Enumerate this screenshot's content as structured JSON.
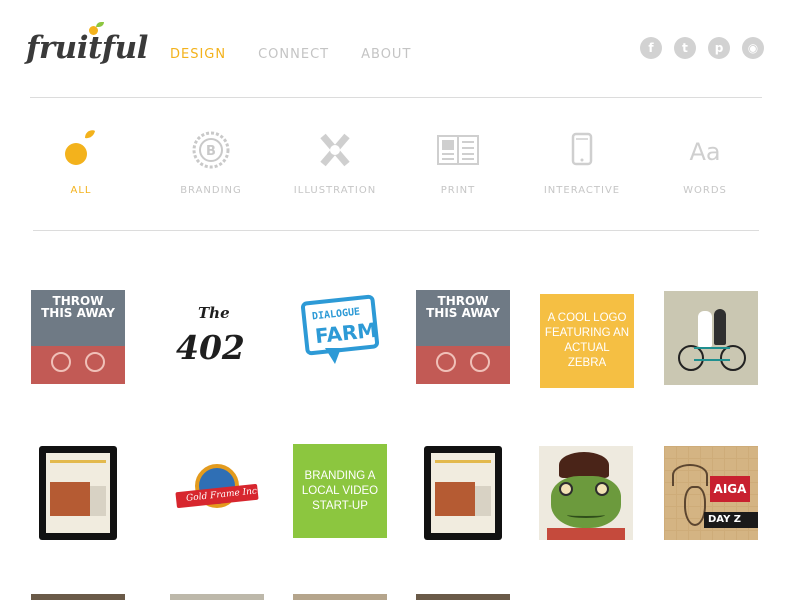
{
  "header": {
    "logo_text": "fruitful",
    "nav": [
      {
        "label": "DESIGN",
        "active": true
      },
      {
        "label": "CONNECT",
        "active": false
      },
      {
        "label": "ABOUT",
        "active": false
      }
    ],
    "social": [
      {
        "icon": "facebook-icon",
        "glyph": "f"
      },
      {
        "icon": "twitter-icon",
        "glyph": "t"
      },
      {
        "icon": "pinterest-icon",
        "glyph": "p"
      },
      {
        "icon": "instagram-icon",
        "glyph": "◉"
      }
    ]
  },
  "categories": [
    {
      "label": "ALL",
      "icon": "fruit-icon",
      "active": true
    },
    {
      "label": "BRANDING",
      "icon": "badge-b-icon",
      "active": false
    },
    {
      "label": "ILLUSTRATION",
      "icon": "crossed-pencils-icon",
      "active": false
    },
    {
      "label": "PRINT",
      "icon": "newspaper-icon",
      "active": false
    },
    {
      "label": "INTERACTIVE",
      "icon": "tablet-icon",
      "active": false
    },
    {
      "label": "WORDS",
      "icon": "typography-icon",
      "active": false
    }
  ],
  "category_icon_glyphs": {
    "branding": "B",
    "words": "Aa"
  },
  "portfolio": {
    "row1": {
      "poster_text": "THROW THIS AWAY",
      "the402_small": "The",
      "the402_big": "402",
      "dialogue_line1": "DIALOGUE",
      "dialogue_line2": "FARM",
      "poster2_text": "THROW THIS AWAY",
      "zebra_text": "A cool logo featuring an actual zebra"
    },
    "row2": {
      "badge_text": "Gold Frame Inc.",
      "video_text": "Branding a local video start-up",
      "aiga_text": "AIGA",
      "day_text": "DAY Z"
    }
  },
  "colors": {
    "accent": "#f3b21c",
    "muted": "#c4c4c4",
    "green": "#8cc63f"
  }
}
